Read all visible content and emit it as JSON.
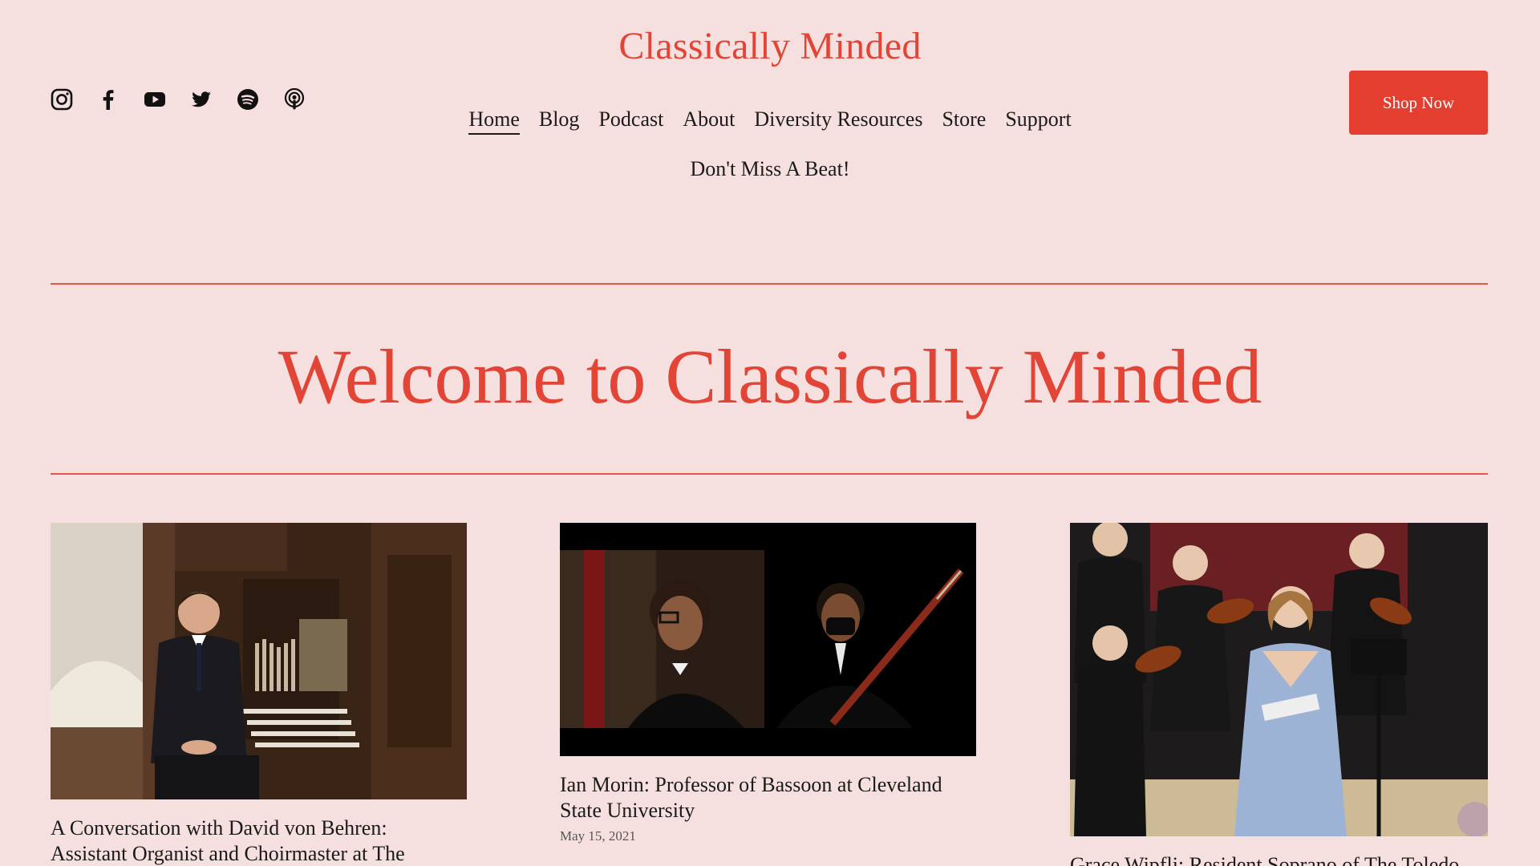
{
  "header": {
    "site_title": "Classically Minded",
    "shop_button": "Shop Now",
    "social_icons": [
      "instagram-icon",
      "facebook-icon",
      "youtube-icon",
      "twitter-icon",
      "spotify-icon",
      "podcast-icon"
    ]
  },
  "nav": {
    "items": [
      "Home",
      "Blog",
      "Podcast",
      "About",
      "Diversity Resources",
      "Store",
      "Support",
      "Don't Miss A Beat!"
    ],
    "active": "Home"
  },
  "hero": {
    "title": "Welcome to Classically Minded"
  },
  "posts": [
    {
      "title": "A Conversation with David von Behren: Assistant Organist and Choirmaster at The Memorial"
    },
    {
      "title": "Ian Morin: Professor of Bassoon at Cleveland State University",
      "date": "May 15, 2021"
    },
    {
      "title": "Grace Wipfli: Resident Soprano of The Toledo"
    }
  ],
  "colors": {
    "background": "#f5e0df",
    "accent": "#e24436",
    "button": "#e33e2f"
  }
}
